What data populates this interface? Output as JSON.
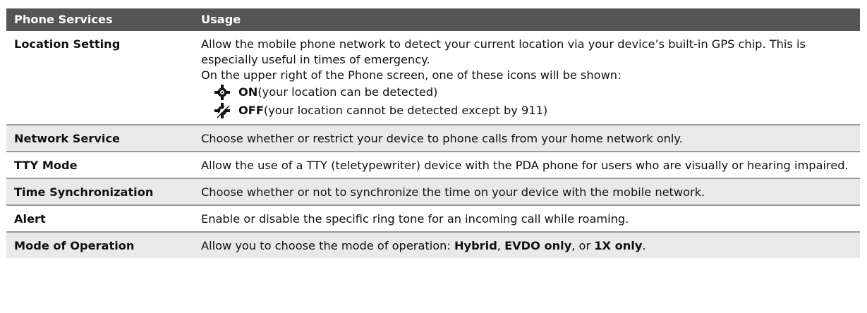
{
  "table": {
    "headers": {
      "service": "Phone Services",
      "usage": "Usage"
    },
    "rows": [
      {
        "service": "Location Setting",
        "usage_lines": [
          "Allow the mobile phone network to detect your current location via your device’s built-in GPS chip. This is especially useful in times of emergency.",
          "On the upper right of the Phone screen, one of these icons will be shown:"
        ],
        "icons": [
          {
            "icon": "location-on-icon",
            "key": "ON",
            "desc": " (your location can be detected)"
          },
          {
            "icon": "location-off-icon",
            "key": "OFF",
            "desc": " (your location cannot be detected except by 911)"
          }
        ]
      },
      {
        "service": "Network Service",
        "usage": "Choose whether or restrict your device to phone calls from your home network only."
      },
      {
        "service": "TTY Mode",
        "usage": "Allow the use of a TTY (teletypewriter) device with the PDA phone for users who are visually or hearing impaired."
      },
      {
        "service": "Time Synchronization",
        "usage": "Choose whether or not to synchronize the time on your device with the mobile network."
      },
      {
        "service": "Alert",
        "usage": "Enable or disable the specific ring tone for an incoming call while roaming."
      },
      {
        "service": "Mode of Operation",
        "usage_parts": {
          "intro": "Allow you to choose the mode of operation: ",
          "opt1": "Hybrid",
          "sep1": ", ",
          "opt2": "EVDO only",
          "sep2": ", or ",
          "opt3": "1X only",
          "end": "."
        }
      }
    ]
  },
  "colors": {
    "header_bg": "#555555",
    "header_text": "#ffffff",
    "shaded_row": "#e9e9e9",
    "divider": "#9a9a9a"
  }
}
